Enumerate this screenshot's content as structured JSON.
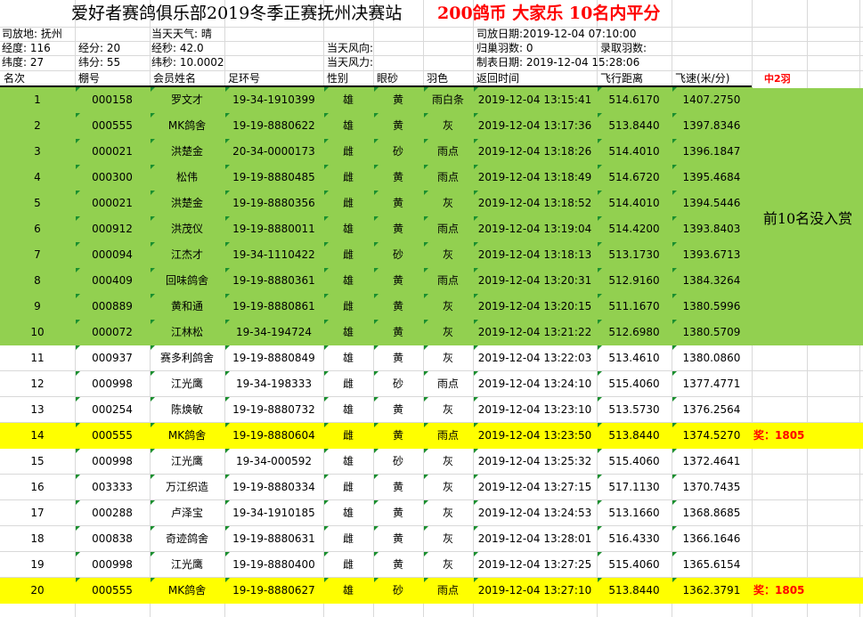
{
  "title": {
    "main": "爱好者赛鸽俱乐部2019冬季正赛抚州决赛站",
    "highlight": "200鸽币 大家乐 10名内平分"
  },
  "info": {
    "release_place": "司放地: 抚州",
    "weather": "当天天气: 晴",
    "release_date": "司放日期:2019-12-04 07:10:00",
    "longitude_deg": "经度: 116",
    "longitude_min": "经分: 20",
    "longitude_sec": "经秒: 42.0",
    "wind_dir": "当天风向:",
    "return_count": "归巢羽数: 0",
    "ranked_count": "录取羽数:",
    "latitude_deg": "纬度:  27",
    "latitude_min": "纬分: 55",
    "latitude_sec": "纬秒: 10.0002",
    "wind_force": "当天风力:",
    "made_date": "制表日期: 2019-12-04 15:28:06"
  },
  "headers": {
    "rank": "名次",
    "loft": "棚号",
    "member": "会员姓名",
    "ring": "足环号",
    "sex": "性别",
    "eye": "眼砂",
    "color": "羽色",
    "return_time": "返回时间",
    "distance": "飞行距离",
    "speed": "飞速(米/分)",
    "note": "中2羽"
  },
  "merged_note": "前10名没入赏",
  "colors": {
    "green_fill": "#92d050",
    "yellow_fill": "#ffff00",
    "bonus_text": "#ff0000",
    "corner_marker": "#1a8f2f"
  },
  "rows": [
    {
      "rank": "1",
      "loft": "000158",
      "member": "罗文才",
      "ring": "19-34-1910399",
      "sex": "雄",
      "eye": "黄",
      "color": "雨白条",
      "time": "2019-12-04 13:15:41",
      "distance": "514.6170",
      "speed": "1407.2750",
      "bonus": "",
      "fill": "green"
    },
    {
      "rank": "2",
      "loft": "000555",
      "member": "MK鸽舍",
      "ring": "19-19-8880622",
      "sex": "雄",
      "eye": "黄",
      "color": "灰",
      "time": "2019-12-04 13:17:36",
      "distance": "513.8440",
      "speed": "1397.8346",
      "bonus": "",
      "fill": "green"
    },
    {
      "rank": "3",
      "loft": "000021",
      "member": "洪楚金",
      "ring": "20-34-0000173",
      "sex": "雌",
      "eye": "砂",
      "color": "雨点",
      "time": "2019-12-04 13:18:26",
      "distance": "514.4010",
      "speed": "1396.1847",
      "bonus": "",
      "fill": "green"
    },
    {
      "rank": "4",
      "loft": "000300",
      "member": "松伟",
      "ring": "19-19-8880485",
      "sex": "雌",
      "eye": "黄",
      "color": "雨点",
      "time": "2019-12-04 13:18:49",
      "distance": "514.6720",
      "speed": "1395.4684",
      "bonus": "",
      "fill": "green"
    },
    {
      "rank": "5",
      "loft": "000021",
      "member": "洪楚金",
      "ring": "19-19-8880356",
      "sex": "雌",
      "eye": "黄",
      "color": "灰",
      "time": "2019-12-04 13:18:52",
      "distance": "514.4010",
      "speed": "1394.5446",
      "bonus": "",
      "fill": "green"
    },
    {
      "rank": "6",
      "loft": "000912",
      "member": "洪茂仪",
      "ring": "19-19-8880011",
      "sex": "雄",
      "eye": "黄",
      "color": "雨点",
      "time": "2019-12-04 13:19:04",
      "distance": "514.4200",
      "speed": "1393.8403",
      "bonus": "",
      "fill": "green"
    },
    {
      "rank": "7",
      "loft": "000094",
      "member": "江杰才",
      "ring": "19-34-1110422",
      "sex": "雌",
      "eye": "砂",
      "color": "灰",
      "time": "2019-12-04 13:18:13",
      "distance": "513.1730",
      "speed": "1393.6713",
      "bonus": "",
      "fill": "green"
    },
    {
      "rank": "8",
      "loft": "000409",
      "member": "回味鸽舍",
      "ring": "19-19-8880361",
      "sex": "雄",
      "eye": "黄",
      "color": "雨点",
      "time": "2019-12-04 13:20:31",
      "distance": "512.9160",
      "speed": "1384.3264",
      "bonus": "",
      "fill": "green"
    },
    {
      "rank": "9",
      "loft": "000889",
      "member": "黄和通",
      "ring": "19-19-8880861",
      "sex": "雌",
      "eye": "黄",
      "color": "灰",
      "time": "2019-12-04 13:20:15",
      "distance": "511.1670",
      "speed": "1380.5996",
      "bonus": "",
      "fill": "green"
    },
    {
      "rank": "10",
      "loft": "000072",
      "member": "江林松",
      "ring": "19-34-194724",
      "sex": "雄",
      "eye": "黄",
      "color": "灰",
      "time": "2019-12-04 13:21:22",
      "distance": "512.6980",
      "speed": "1380.5709",
      "bonus": "",
      "fill": "green"
    },
    {
      "rank": "11",
      "loft": "000937",
      "member": "赛多利鸽舍",
      "ring": "19-19-8880849",
      "sex": "雄",
      "eye": "黄",
      "color": "灰",
      "time": "2019-12-04 13:22:03",
      "distance": "513.4610",
      "speed": "1380.0860",
      "bonus": "",
      "fill": "none"
    },
    {
      "rank": "12",
      "loft": "000998",
      "member": "江光鹰",
      "ring": "19-34-198333",
      "sex": "雌",
      "eye": "砂",
      "color": "雨点",
      "time": "2019-12-04 13:24:10",
      "distance": "515.4060",
      "speed": "1377.4771",
      "bonus": "",
      "fill": "none"
    },
    {
      "rank": "13",
      "loft": "000254",
      "member": "陈焕敏",
      "ring": "19-19-8880732",
      "sex": "雄",
      "eye": "黄",
      "color": "灰",
      "time": "2019-12-04 13:23:10",
      "distance": "513.5730",
      "speed": "1376.2564",
      "bonus": "",
      "fill": "none"
    },
    {
      "rank": "14",
      "loft": "000555",
      "member": "MK鸽舍",
      "ring": "19-19-8880604",
      "sex": "雌",
      "eye": "黄",
      "color": "雨点",
      "time": "2019-12-04 13:23:50",
      "distance": "513.8440",
      "speed": "1374.5270",
      "bonus": "奖：1805",
      "fill": "yellow"
    },
    {
      "rank": "15",
      "loft": "000998",
      "member": "江光鹰",
      "ring": "19-34-000592",
      "sex": "雄",
      "eye": "砂",
      "color": "灰",
      "time": "2019-12-04 13:25:32",
      "distance": "515.4060",
      "speed": "1372.4641",
      "bonus": "",
      "fill": "none"
    },
    {
      "rank": "16",
      "loft": "003333",
      "member": "万江织造",
      "ring": "19-19-8880334",
      "sex": "雌",
      "eye": "黄",
      "color": "灰",
      "time": "2019-12-04 13:27:15",
      "distance": "517.1130",
      "speed": "1370.7435",
      "bonus": "",
      "fill": "none"
    },
    {
      "rank": "17",
      "loft": "000288",
      "member": "卢泽宝",
      "ring": "19-34-1910185",
      "sex": "雄",
      "eye": "黄",
      "color": "灰",
      "time": "2019-12-04 13:24:53",
      "distance": "513.1660",
      "speed": "1368.8685",
      "bonus": "",
      "fill": "none"
    },
    {
      "rank": "18",
      "loft": "000838",
      "member": "奇迹鸽舍",
      "ring": "19-19-8880631",
      "sex": "雌",
      "eye": "黄",
      "color": "灰",
      "time": "2019-12-04 13:28:01",
      "distance": "516.4330",
      "speed": "1366.1646",
      "bonus": "",
      "fill": "none"
    },
    {
      "rank": "19",
      "loft": "000998",
      "member": "江光鹰",
      "ring": "19-19-8880400",
      "sex": "雌",
      "eye": "黄",
      "color": "灰",
      "time": "2019-12-04 13:27:25",
      "distance": "515.4060",
      "speed": "1365.6154",
      "bonus": "",
      "fill": "none"
    },
    {
      "rank": "20",
      "loft": "000555",
      "member": "MK鸽舍",
      "ring": "19-19-8880627",
      "sex": "雄",
      "eye": "砂",
      "color": "雨点",
      "time": "2019-12-04 13:27:10",
      "distance": "513.8440",
      "speed": "1362.3791",
      "bonus": "奖：1805",
      "fill": "yellow"
    }
  ]
}
